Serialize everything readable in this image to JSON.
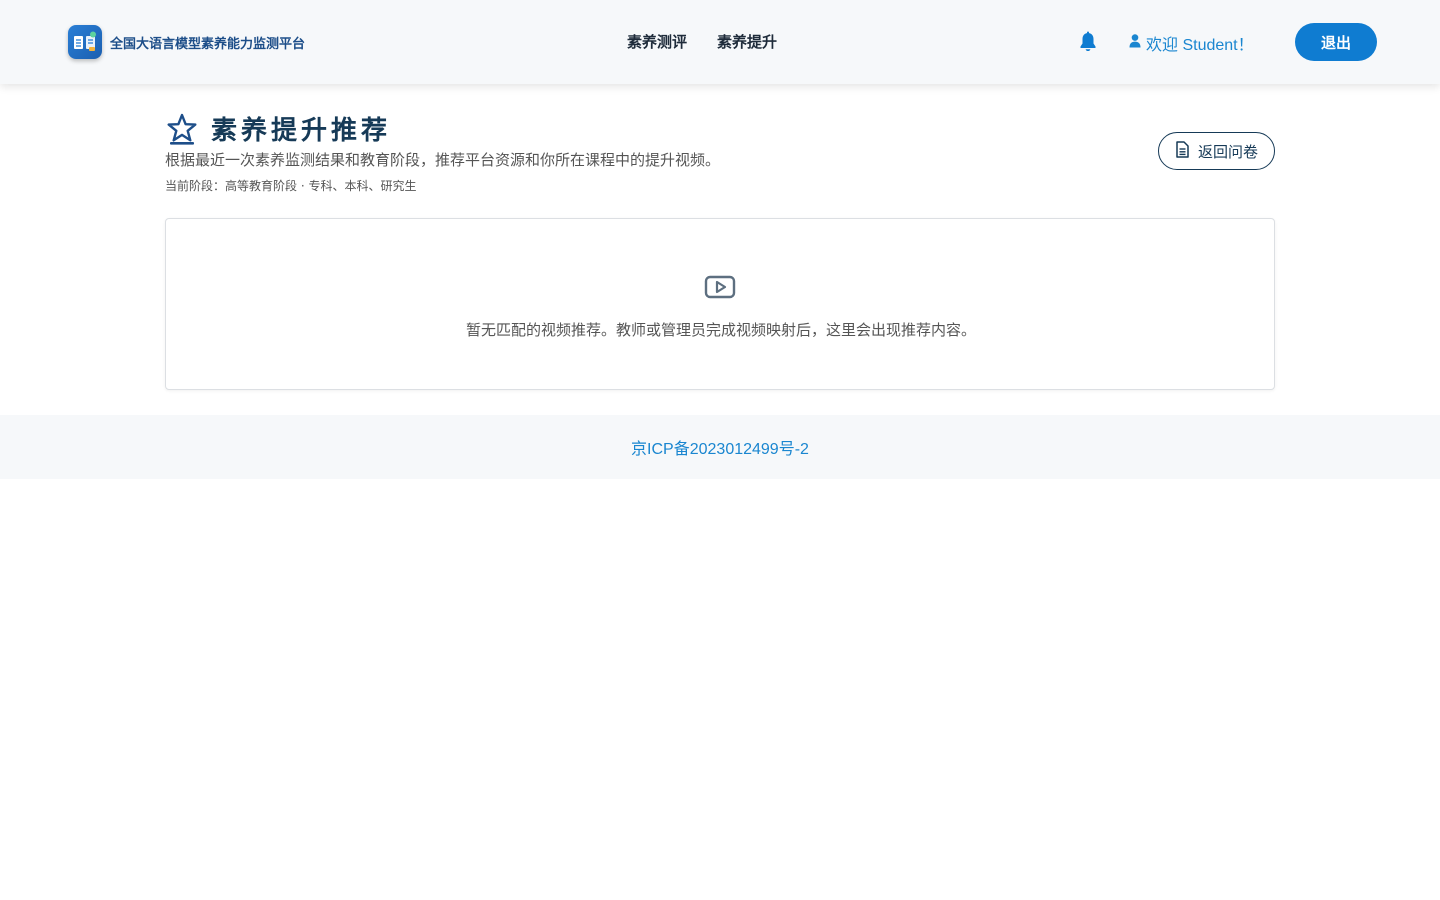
{
  "header": {
    "brand_name": "全国大语言模型素养能力监测平台",
    "logo_icon": "book-chat-logo-icon",
    "nav": [
      {
        "label": "素养测评"
      },
      {
        "label": "素养提升"
      }
    ],
    "notification_icon": "bell-icon",
    "welcome": "欢迎 Student！",
    "user_icon": "user-icon",
    "logout_label": "退出"
  },
  "main": {
    "title_icon": "star-icon",
    "title": "素养提升推荐",
    "subtitle": "根据最近一次素养监测结果和教育阶段，推荐平台资源和你所在课程中的提升视频。",
    "stage": "当前阶段：高等教育阶段 · 专科、本科、研究生",
    "back_button": {
      "icon": "document-icon",
      "label": "返回问卷"
    },
    "empty_state": {
      "icon": "video-play-icon",
      "text": "暂无匹配的视频推荐。教师或管理员完成视频映射后，这里会出现推荐内容。"
    }
  },
  "footer": {
    "icp": "京ICP备2023012499号-2"
  },
  "colors": {
    "accent": "#0f7cd1",
    "link": "#1a86d0",
    "title": "#163a57",
    "header_bg": "#f6f8fa"
  }
}
